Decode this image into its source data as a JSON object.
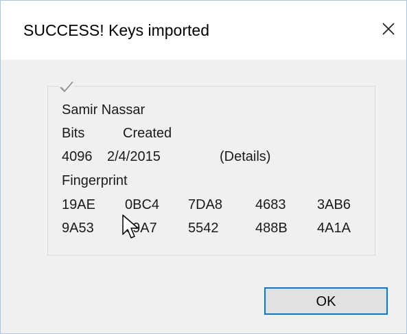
{
  "dialog": {
    "title": "SUCCESS! Keys imported",
    "close_icon": "close-icon",
    "status_icon": "checkmark-icon"
  },
  "key": {
    "name": "Samir Nassar",
    "bits_label": "Bits",
    "created_label": "Created",
    "bits": "4096",
    "created": "2/4/2015",
    "details_link": "(Details)",
    "fingerprint_label": "Fingerprint",
    "fingerprint": [
      [
        "19AE",
        "0BC4",
        "7DA8",
        "4683",
        "3AB6"
      ],
      [
        "9A53",
        "69A7",
        "5542",
        "488B",
        "4A1A"
      ]
    ]
  },
  "buttons": {
    "ok": "OK"
  },
  "colors": {
    "accent": "#0078d7",
    "dialog_background": "#f0f0f0"
  }
}
